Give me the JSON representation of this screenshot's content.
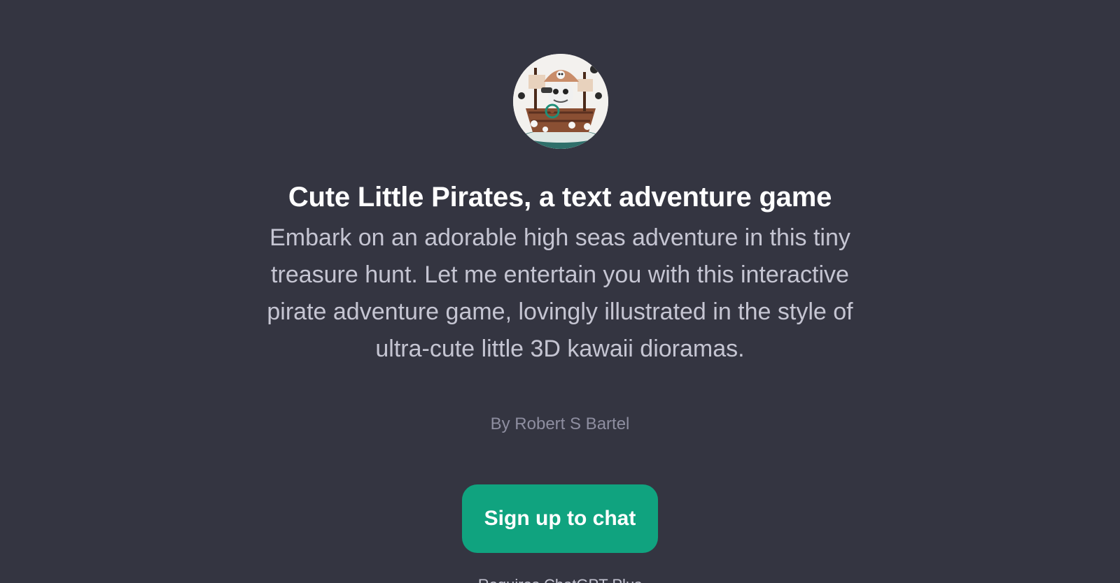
{
  "gpt": {
    "avatar_icon": "pirate-ship-diorama-image",
    "title": "Cute Little Pirates, a text adventure game",
    "description": "Embark on an adorable high seas adventure in this tiny treasure hunt. Let me entertain you with this interactive pirate adventure game, lovingly illustrated in the style of ultra-cute little 3D kawaii dioramas.",
    "author": "By Robert S Bartel"
  },
  "actions": {
    "signup_label": "Sign up to chat"
  },
  "footer": {
    "note": "Requires ChatGPT Plus"
  },
  "colors": {
    "background": "#343541",
    "accent": "#10a37f",
    "title": "#ffffff",
    "text": "#c5c5d2",
    "muted": "#8e8ea0"
  }
}
